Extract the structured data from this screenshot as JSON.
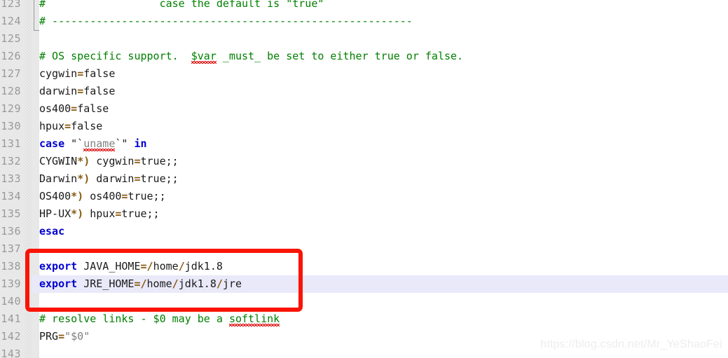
{
  "editor": {
    "first_line": 123,
    "last_line": 143,
    "current_line": 139,
    "gutter_bg": "#e8e8e8",
    "code_bg": "#ffffff",
    "current_line_highlight": "#e9e9fa",
    "keyword_color": "#0000d0",
    "comment_color": "#008000",
    "operator_color": "#8a5a10",
    "text_color": "#1b1b1b"
  },
  "annotation": {
    "box_color": "#fa1405",
    "covers_lines": "137-140"
  },
  "watermark": {
    "text": "https://blog.csdn.net/Mr_YeShaoFei",
    "color": "#ededed"
  },
  "lines": [
    {
      "n": "123",
      "text": "#                  case the default is \"true\""
    },
    {
      "n": "124",
      "text": "# ---------------------------------------------------------"
    },
    {
      "n": "125",
      "text": ""
    },
    {
      "n": "126",
      "text": "# OS specific support.  $var _must_ be set to either true or false."
    },
    {
      "n": "127",
      "text": "cygwin=false"
    },
    {
      "n": "128",
      "text": "darwin=false"
    },
    {
      "n": "129",
      "text": "os400=false"
    },
    {
      "n": "130",
      "text": "hpux=false"
    },
    {
      "n": "131",
      "text": "case \"`uname`\" in"
    },
    {
      "n": "132",
      "text": "CYGWIN*) cygwin=true;;"
    },
    {
      "n": "133",
      "text": "Darwin*) darwin=true;;"
    },
    {
      "n": "134",
      "text": "OS400*) os400=true;;"
    },
    {
      "n": "135",
      "text": "HP-UX*) hpux=true;;"
    },
    {
      "n": "136",
      "text": "esac"
    },
    {
      "n": "137",
      "text": ""
    },
    {
      "n": "138",
      "text": "export JAVA_HOME=/home/jdk1.8"
    },
    {
      "n": "139",
      "text": "export JRE_HOME=/home/jdk1.8/jre"
    },
    {
      "n": "140",
      "text": ""
    },
    {
      "n": "141",
      "text": "# resolve links - $0 may be a softlink"
    },
    {
      "n": "142",
      "text": "PRG=\"$0\""
    },
    {
      "n": "143",
      "text": ""
    }
  ],
  "tokens": {
    "l123_comment": "#                  case the default is \"true\"",
    "l124_comment": "# ---------------------------------------------------------",
    "l126_comment_a": "# OS specific support.  ",
    "l126_var": "$var",
    "l126_comment_b": " _must_ be set to either true or false.",
    "l127_name": "cygwin",
    "l127_eq": "=",
    "l127_val": "false",
    "l128_name": "darwin",
    "l128_eq": "=",
    "l128_val": "false",
    "l129_name": "os400",
    "l129_eq": "=",
    "l129_val": "false",
    "l130_name": "hpux",
    "l130_eq": "=",
    "l130_val": "false",
    "l131_case": "case",
    "l131_q1": " \"`",
    "l131_uname": "uname",
    "l131_q2": "`\" ",
    "l131_in": "in",
    "l132_pat": "CYGWIN",
    "l132_op": "*)",
    "l132_name": " cygwin",
    "l132_eq": "=",
    "l132_val": "true;;",
    "l133_pat": "Darwin",
    "l133_op": "*)",
    "l133_name": " darwin",
    "l133_eq": "=",
    "l133_val": "true;;",
    "l134_pat": "OS400",
    "l134_op": "*)",
    "l134_name": " os400",
    "l134_eq": "=",
    "l134_val": "true;;",
    "l135_pat": "HP-UX",
    "l135_op": "*)",
    "l135_name": " hpux",
    "l135_eq": "=",
    "l135_val": "true;;",
    "l136_esac": "esac",
    "l138_export": "export",
    "l138_var": " JAVA_HOME",
    "l138_eq": "=",
    "l138_s1": "/",
    "l138_p1": "home",
    "l138_s2": "/",
    "l138_p2": "jdk1.8",
    "l139_export": "export",
    "l139_var": " JRE_HOME",
    "l139_eq": "=",
    "l139_s1": "/",
    "l139_p1": "home",
    "l139_s2": "/",
    "l139_p2": "jdk1.8",
    "l139_s3": "/",
    "l139_p3": "jre",
    "l141_comment_a": "# resolve links - $0 may be a ",
    "l141_softlink": "softlink",
    "l142_name": "PRG",
    "l142_eq": "=",
    "l142_val": "\"$0\""
  }
}
